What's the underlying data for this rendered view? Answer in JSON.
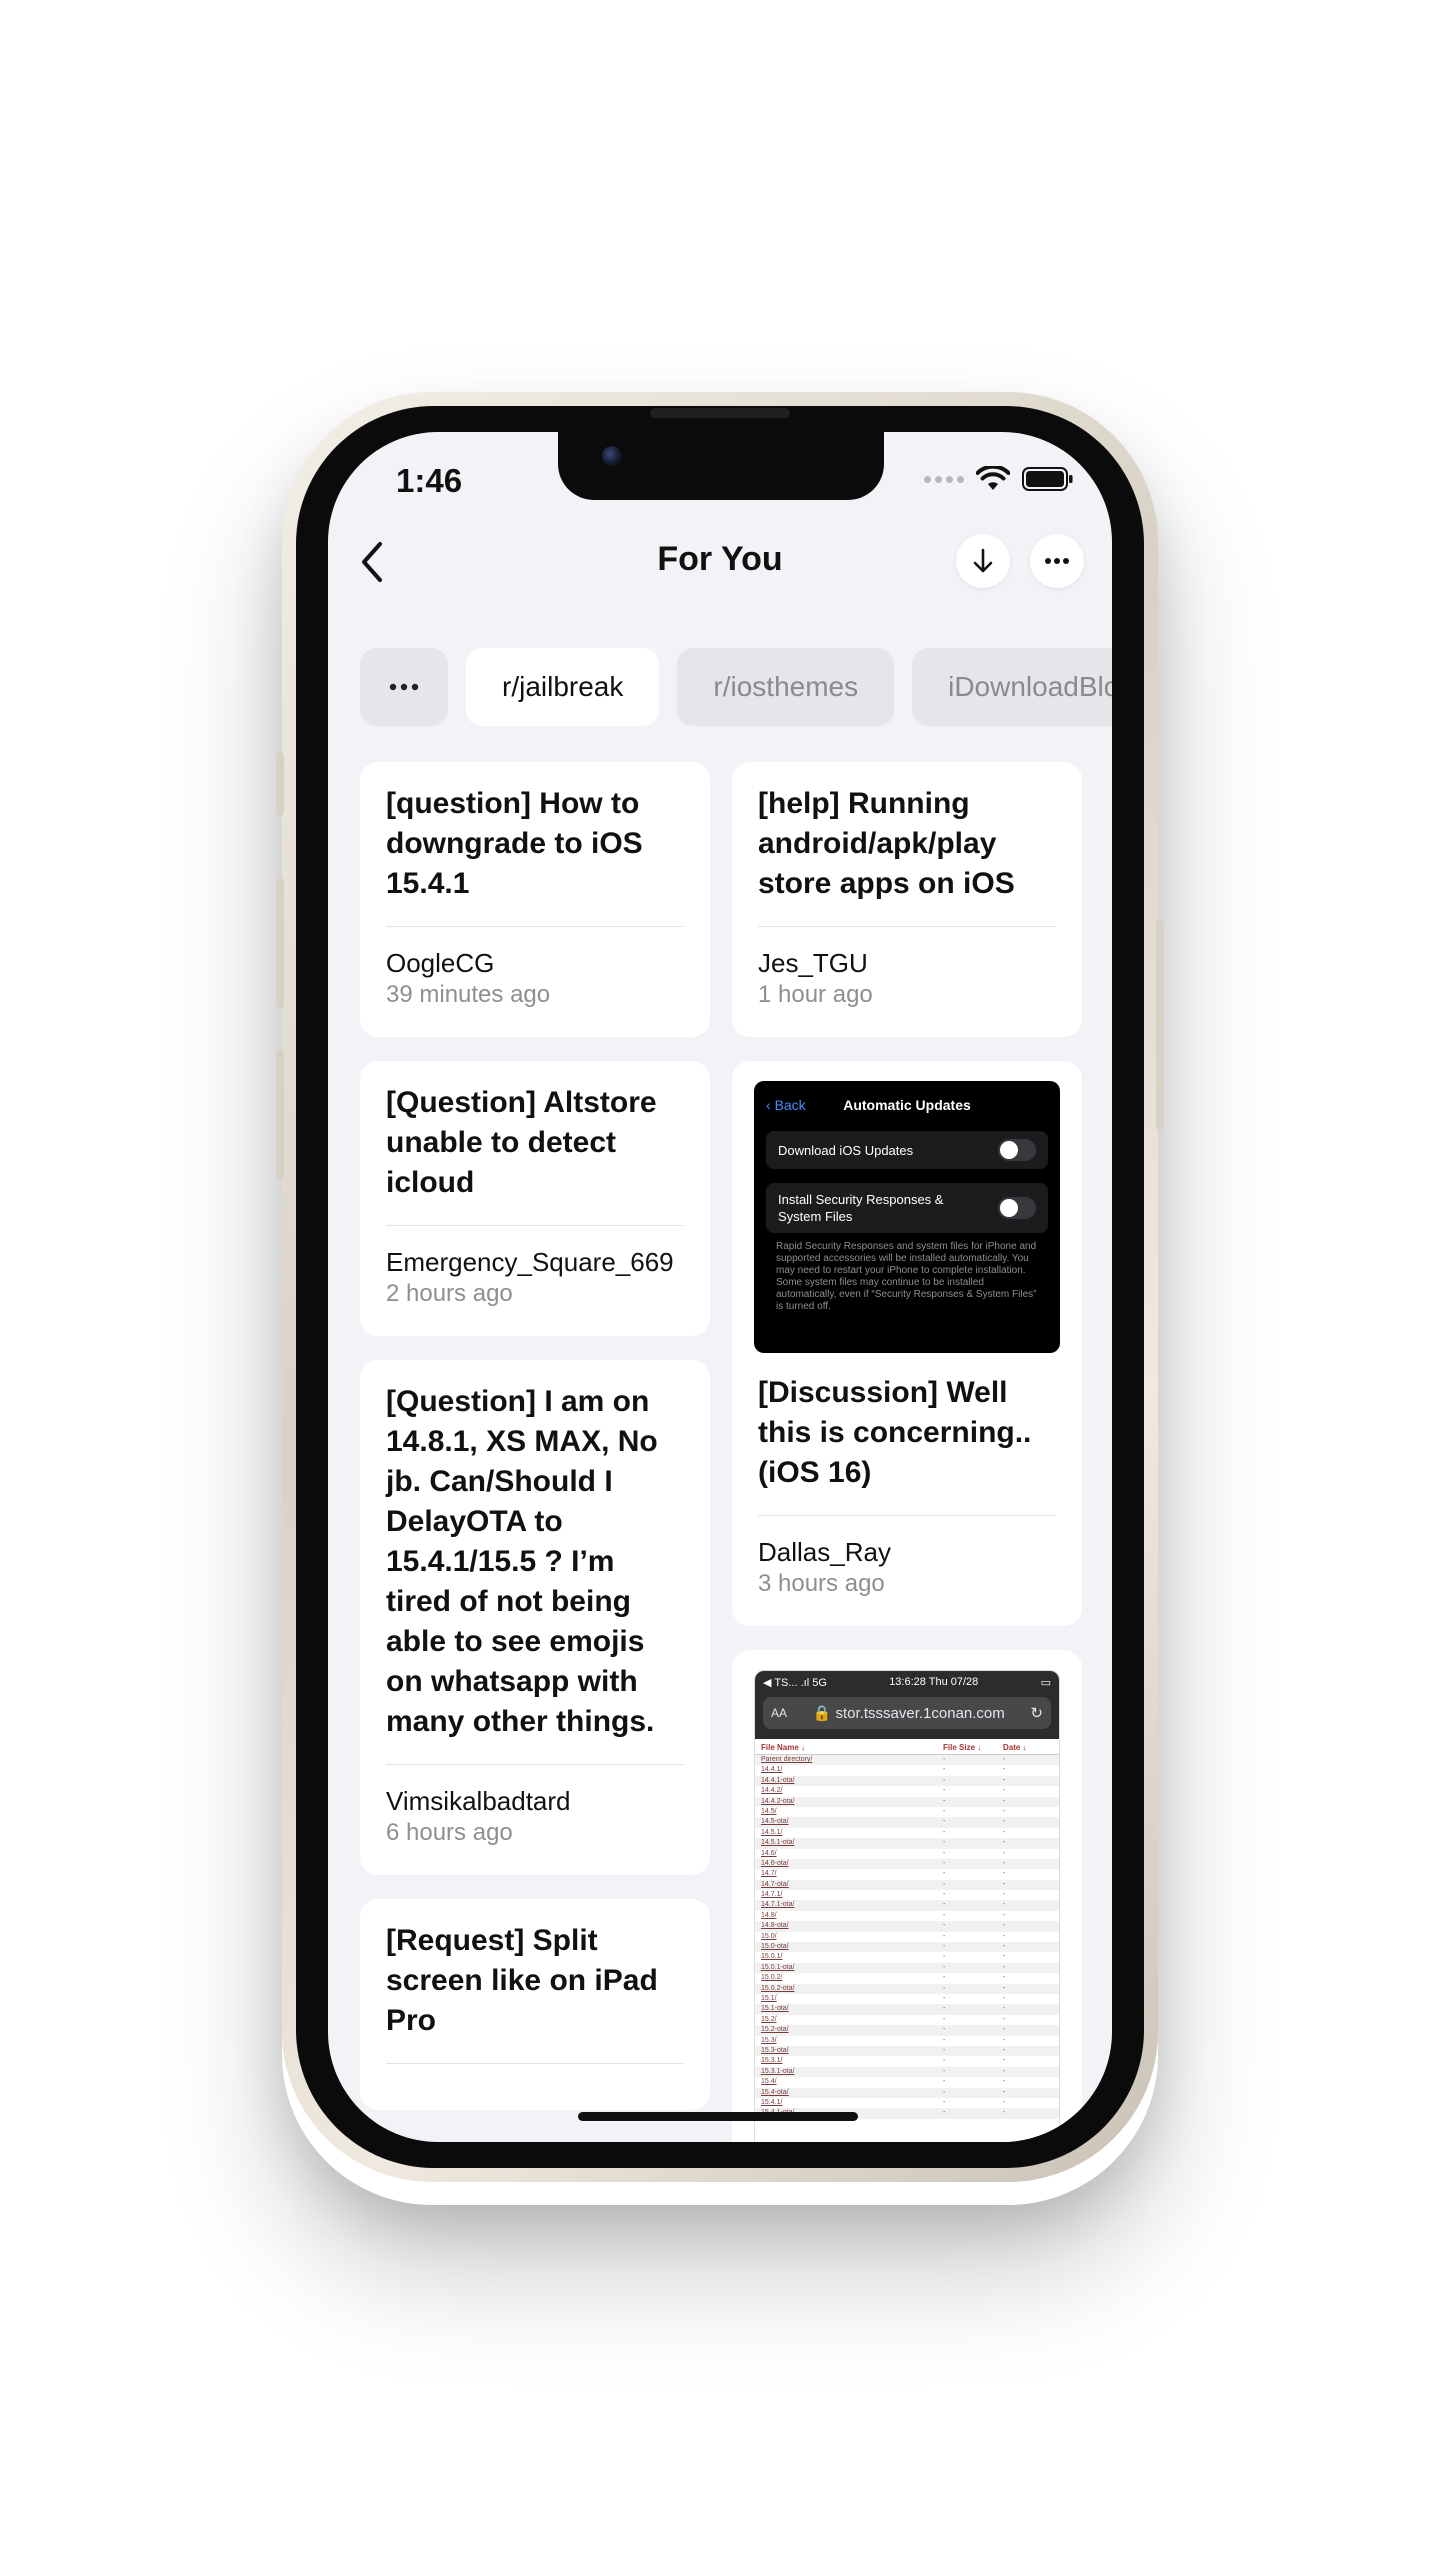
{
  "status_bar": {
    "time": "1:46"
  },
  "header": {
    "title": "For You"
  },
  "chips": [
    {
      "label": "r/jailbreak",
      "active": true
    },
    {
      "label": "r/iosthemes",
      "active": false
    },
    {
      "label": "iDownloadBlog",
      "active": false
    }
  ],
  "left_column": [
    {
      "title": "[question] How to downgrade to iOS 15.4.1",
      "author": "OogleCG",
      "time": "39 minutes ago"
    },
    {
      "title": "[Question] Altstore unable to detect icloud",
      "author": "Emergency_Square_669",
      "time": "2 hours ago"
    },
    {
      "title": "[Question] I am on 14.8.1, XS MAX, No jb. Can/Should I DelayOTA to 15.4.1/15.5 ? I’m tired of not being able to see emojis on whatsapp with many other things.",
      "author": "Vimsikalbadtard",
      "time": "6 hours ago"
    },
    {
      "title": "[Request] Split screen like on iPad Pro",
      "author": "",
      "time": ""
    }
  ],
  "right_column": [
    {
      "title": "[help] Running android/apk/play store apps on iOS",
      "author": "Jes_TGU",
      "time": "1 hour ago"
    },
    {
      "title": "[Discussion] Well this is concerning.. (iOS 16)",
      "author": "Dallas_Ray",
      "time": "3 hours ago"
    }
  ],
  "thumb_settings": {
    "back": "Back",
    "title": "Automatic Updates",
    "row1": "Download iOS Updates",
    "row2": "Install Security Responses & System Files",
    "note": "Rapid Security Responses and system files for iPhone and supported accessories will be installed automatically. You may need to restart your iPhone to complete installation. Some system files may continue to be installed automatically, even if “Security Responses & System Files” is turned off."
  },
  "thumb_listing": {
    "status_left": "◀ TS...  .ıl 5G",
    "status_time": "13:6:28  Thu 07/28",
    "url_aa": "AA",
    "url": "stor.tsssaver.1conan.com",
    "col_name": "File Name ↓",
    "col_size": "File Size ↓",
    "col_date": "Date ↓",
    "rows": [
      "Parent directory/",
      "14.4.1/",
      "14.4.1-ota/",
      "14.4.2/",
      "14.4.2-ota/",
      "14.5/",
      "14.5-ota/",
      "14.5.1/",
      "14.5.1-ota/",
      "14.6/",
      "14.6-ota/",
      "14.7/",
      "14.7-ota/",
      "14.7.1/",
      "14.7.1-ota/",
      "14.8/",
      "14.8-ota/",
      "15.0/",
      "15.0-ota/",
      "15.0.1/",
      "15.0.1-ota/",
      "15.0.2/",
      "15.0.2-ota/",
      "15.1/",
      "15.1-ota/",
      "15.2/",
      "15.2-ota/",
      "15.3/",
      "15.3-ota/",
      "15.3.1/",
      "15.3.1-ota/",
      "15.4/",
      "15.4-ota/",
      "15.4.1/",
      "15.4.1-ota/"
    ],
    "cell": "-"
  }
}
